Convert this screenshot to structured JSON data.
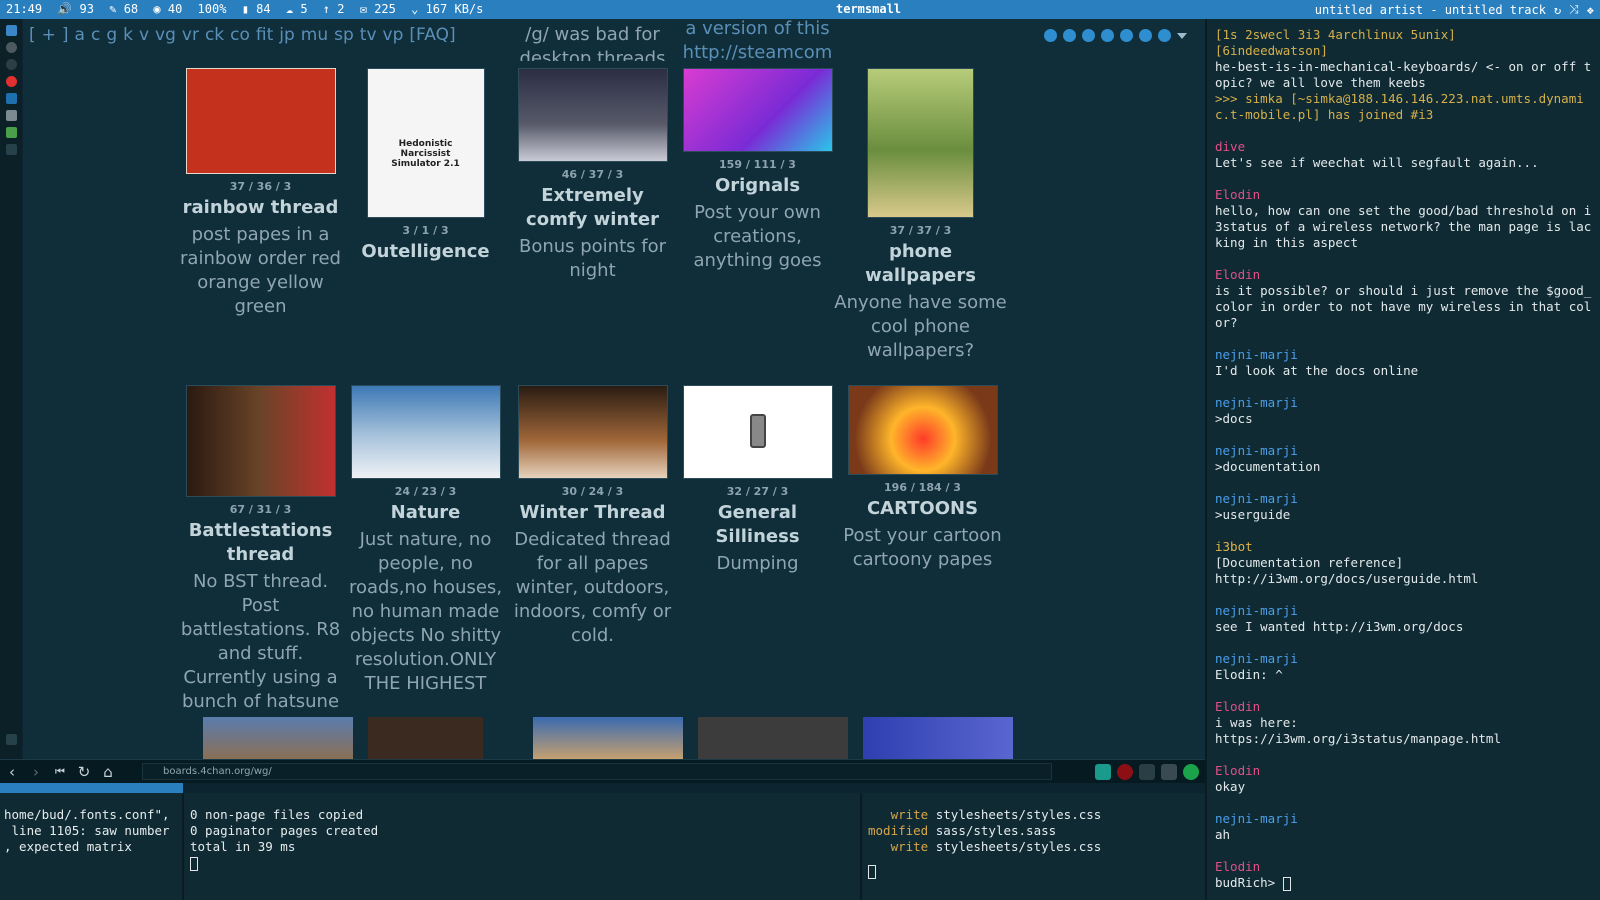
{
  "topbar": {
    "time": "21:49",
    "volume": "93",
    "brightness": "68",
    "eye": "40",
    "battery_pct": "100%",
    "mem": "84",
    "cpu": "5",
    "updates": "2",
    "mail": "225",
    "net": "167 KB/s",
    "window_title": "termsmall",
    "music": "untitled artist - untitled track"
  },
  "boardnav": [
    "[",
    "+",
    "]",
    "a",
    "c",
    "g",
    "k",
    "v",
    "vg",
    "vr",
    "ck",
    "co",
    "fit",
    "jp",
    "mu",
    "sp",
    "tv",
    "vp",
    "[FAQ]"
  ],
  "partial_top": {
    "col3": "/g/ was bad for desktop threads",
    "col5": "a version of this http://steamcom"
  },
  "catalog": [
    {
      "stats": "37 / 36 / 3",
      "title": "rainbow thread",
      "text": "post papes in a rainbow order red orange yellow green",
      "thumb_color": "#c4321e"
    },
    {
      "stats": "3 / 1 / 3",
      "title": "Outelligence",
      "text": "",
      "thumb_text": "Hedonistic Narcissist Simulator 2.1",
      "thumb_color": "#f5f5f5"
    },
    {
      "stats": "46 / 37 / 3",
      "title": "Extremely comfy winter",
      "text": "Bonus points for night",
      "thumb_color": "#3a3b4a"
    },
    {
      "stats": "159 / 111 / 3",
      "title": "Orignals",
      "text": "Post your own creations, anything goes",
      "thumb_color": "#d93cd1"
    },
    {
      "stats": "37 / 37 / 3",
      "title": "phone wallpapers",
      "text": "Anyone have some cool phone wallpapers?",
      "thumb_color": "#7aa64a"
    },
    {
      "stats": "67 / 31 / 3",
      "title": "Battlestations thread",
      "text": "No BST thread. Post battlestations. R8 and stuff. Currently using a bunch of hatsune",
      "thumb_color": "#4a2e1c"
    },
    {
      "stats": "24 / 23 / 3",
      "title": "Nature",
      "text": "Just nature, no people, no roads,no houses, no human made objects No shitty resolution.ONLY THE HIGHEST",
      "thumb_color": "#8fb4cf"
    },
    {
      "stats": "30 / 24 / 3",
      "title": "Winter Thread",
      "text": "Dedicated thread for all papes winter, outdoors, indoors, comfy or cold.",
      "thumb_color": "#6b4a2a"
    },
    {
      "stats": "32 / 27 / 3",
      "title": "General Silliness",
      "text": "Dumping",
      "thumb_color": "#ffffff"
    },
    {
      "stats": "196 / 184 / 3",
      "title": "CARTOONS",
      "text": "Post your cartoon cartoony papes",
      "thumb_color": "#e8642a"
    }
  ],
  "bottom_thumbs": [
    "#8a6f55",
    "#3a2a20",
    "#5a7dae",
    "#3c3c3c",
    "#3047a8"
  ],
  "browser": {
    "url": "boards.4chan.org/wg/"
  },
  "term1": {
    "lines": [
      "home/bud/.fonts.conf\",",
      " line 1105: saw number",
      ", expected matrix"
    ]
  },
  "term2": {
    "lines": [
      "0 non-page files copied",
      "0 paginator pages created",
      "total in 39 ms"
    ]
  },
  "term3": {
    "rows": [
      {
        "kw": "   write",
        "path": "stylesheets/styles.css"
      },
      {
        "kw": "modified",
        "path": "sass/styles.sass"
      },
      {
        "kw": "   write",
        "path": "stylesheets/styles.css"
      }
    ]
  },
  "irc": {
    "status": "[1s 2swecl 3i3 4archlinux 5unix]",
    "first_nick": "[6indeedwatson]",
    "first_msg": "he-best-is-in-mechanical-keyboards/ <- on or off topic? we all love them keebs",
    "join": ">>> simka [~simka@188.146.146.223.nat.umts.dynamic.t-mobile.pl] has joined #i3",
    "messages": [
      {
        "nick": "dive",
        "color": "pink",
        "text": "Let's see if weechat will segfault again..."
      },
      {
        "nick": "Elodin",
        "color": "pink",
        "text": "hello, how can one set the good/bad threshold on i3status of a wireless network? the man page is lacking in this aspect"
      },
      {
        "nick": "Elodin",
        "color": "pink",
        "text": "is it possible? or should i just remove the $good_color in order to not have my wireless in that color?"
      },
      {
        "nick": "nejni-marji",
        "color": "blue",
        "text": "I'd look at the docs online"
      },
      {
        "nick": "nejni-marji",
        "color": "blue",
        "text": ">docs"
      },
      {
        "nick": "nejni-marji",
        "color": "blue",
        "text": ">documentation"
      },
      {
        "nick": "nejni-marji",
        "color": "blue",
        "text": ">userguide"
      },
      {
        "nick": "i3bot",
        "color": "yellow",
        "text": "[Documentation reference]\nhttp://i3wm.org/docs/userguide.html"
      },
      {
        "nick": "nejni-marji",
        "color": "blue",
        "text": "see I wanted http://i3wm.org/docs"
      },
      {
        "nick": "nejni-marji",
        "color": "blue",
        "text": "Elodin: ^"
      },
      {
        "nick": "Elodin",
        "color": "pink",
        "text": "i was here:\nhttps://i3wm.org/i3status/manpage.html"
      },
      {
        "nick": "Elodin",
        "color": "pink",
        "text": "okay"
      },
      {
        "nick": "nejni-marji",
        "color": "blue",
        "text": "ah"
      },
      {
        "nick": "Elodin",
        "color": "pink",
        "text": ""
      }
    ],
    "prompt": "budRich>"
  }
}
